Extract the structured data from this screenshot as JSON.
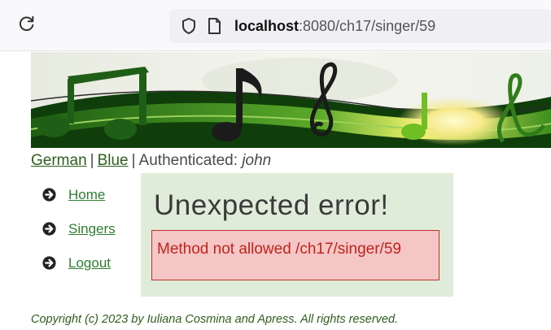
{
  "browser": {
    "url_host": "localhost",
    "url_path": ":8080/ch17/singer/59"
  },
  "header": {
    "lang_link": "German",
    "separator": "|",
    "theme_link": "Blue",
    "auth_label": "Authenticated:",
    "auth_user": "john"
  },
  "menu": {
    "items": [
      {
        "label": "Home"
      },
      {
        "label": "Singers"
      },
      {
        "label": "Logout"
      }
    ]
  },
  "error": {
    "title": "Unexpected error!",
    "message": "Method not allowed /ch17/singer/59"
  },
  "footer": {
    "copyright": "Copyright (c) 2023 by Iuliana Cosmina and Apress. All rights reserved."
  },
  "colors": {
    "link_green": "#2e7d32",
    "panel_bg": "#dfecd9",
    "error_bg": "#f4c6c6",
    "error_text": "#c0241c"
  }
}
